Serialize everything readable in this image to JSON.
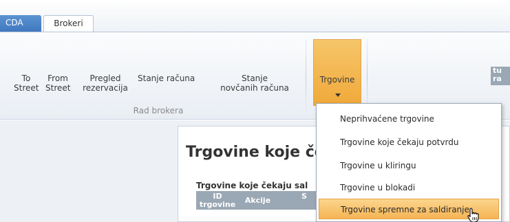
{
  "tabs": [
    {
      "label": "CDA",
      "active": false
    },
    {
      "label": "Brokeri",
      "active": true
    }
  ],
  "ribbon": {
    "buttons": {
      "to_street": {
        "line1": "To",
        "line2": "Street"
      },
      "from_street": {
        "line1": "From",
        "line2": "Street"
      },
      "pregled": {
        "line1": "Pregled",
        "line2": "rezervacija"
      },
      "stanje": {
        "line1": "Stanje računa",
        "line2": ""
      },
      "novcani": {
        "line1": "Stanje",
        "line2": "novčanih računa"
      },
      "trgovine": {
        "label": "Trgovine"
      }
    },
    "group_label": "Rad brokera"
  },
  "panel": {
    "title": "Trgovine koje če",
    "subtitle": "Trgovine koje čekaju sal",
    "columns": [
      {
        "line1": "ID",
        "line2": "trgovine"
      },
      {
        "line1": "Akcije",
        "line2": ""
      },
      {
        "line1": "S",
        "line2": ""
      }
    ],
    "right_column_fragment": {
      "line1": "tu",
      "line2": "ra"
    }
  },
  "menu": {
    "items": [
      "Neprihvaćene trgovine",
      "Trgovine koje čekaju potvrdu",
      "Trgovine u kliringu",
      "Trgovine u blokadi",
      "Trgovine spremne za saldiranje"
    ],
    "highlighted_index": 4
  },
  "colors": {
    "accent_orange": "#f0a93a",
    "tab_blue": "#3f78c0",
    "table_header": "#9aa7b4"
  },
  "cursor": {
    "icon": "hand-pointer-icon"
  }
}
